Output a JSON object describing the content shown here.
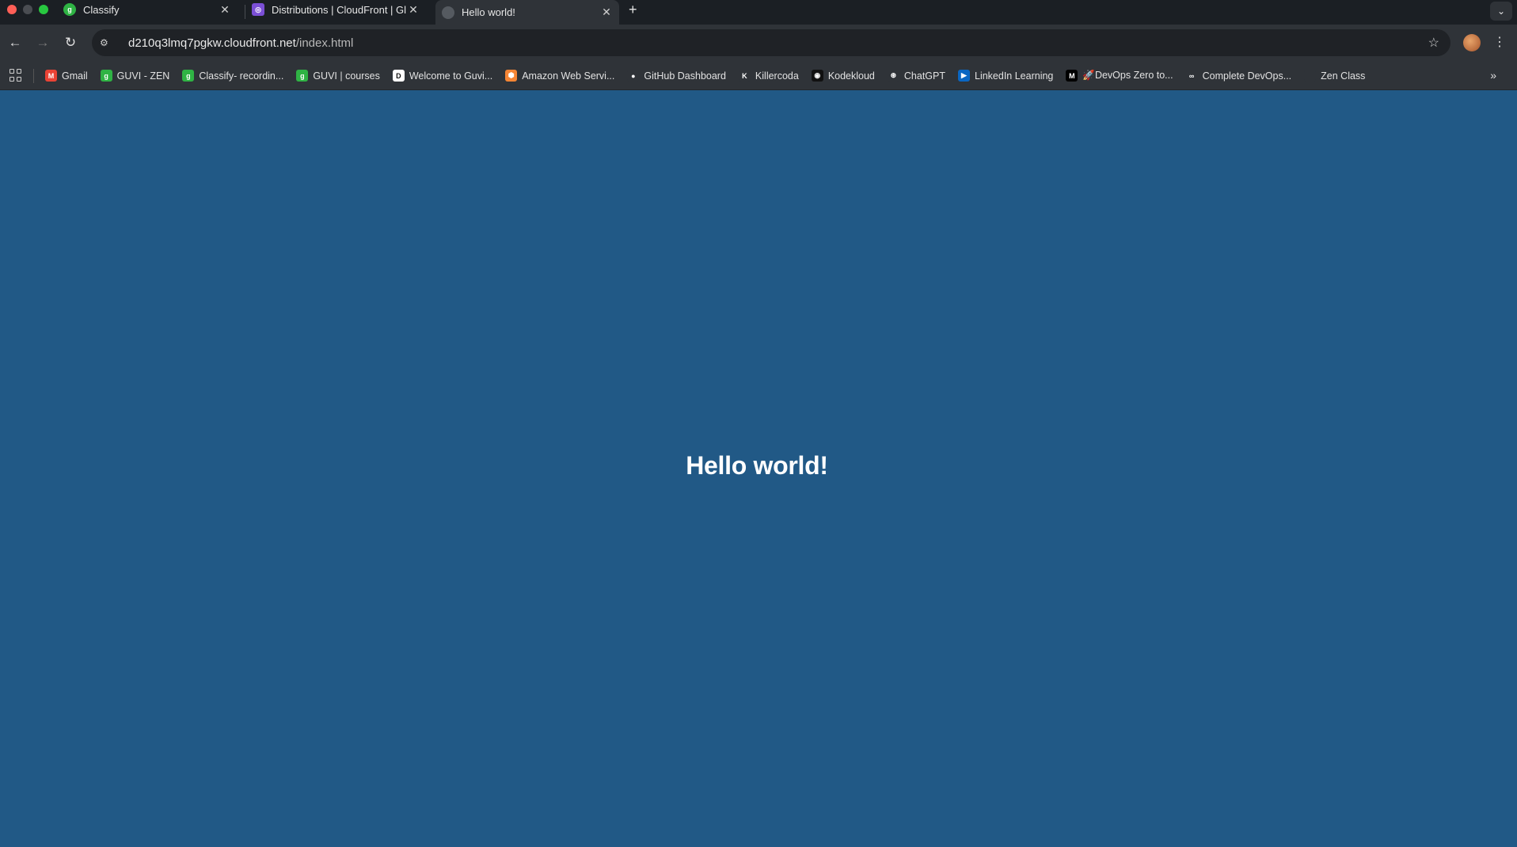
{
  "window": {
    "tabs": [
      {
        "title": "Classify",
        "icon": "guvi-icon",
        "active": false
      },
      {
        "title": "Distributions | CloudFront | Gl",
        "icon": "cloudfront-icon",
        "active": false
      },
      {
        "title": "Hello world!",
        "icon": "globe-icon",
        "active": true
      }
    ],
    "new_tab": "+",
    "tab_list": "⌄"
  },
  "toolbar": {
    "back": "←",
    "forward": "→",
    "reload": "↻",
    "url_host": "d210q3lmq7pgkw.cloudfront.net",
    "url_path": "/index.html",
    "star": "☆",
    "menu": "⋮"
  },
  "bookmarks": {
    "items": [
      {
        "label": "Gmail",
        "icon": "gmail-icon",
        "color": "#ea4335",
        "glyph": "M"
      },
      {
        "label": "GUVI - ZEN",
        "icon": "guvi-icon",
        "color": "#2fb344",
        "glyph": "g"
      },
      {
        "label": "Classify- recordin...",
        "icon": "guvi-icon",
        "color": "#2fb344",
        "glyph": "g"
      },
      {
        "label": "GUVI | courses",
        "icon": "guvi-icon",
        "color": "#2fb344",
        "glyph": "g"
      },
      {
        "label": "Welcome to Guvi...",
        "icon": "doc-icon",
        "color": "#ffffff",
        "glyph": "D"
      },
      {
        "label": "Amazon Web Servi...",
        "icon": "aws-icon",
        "color": "#f58534",
        "glyph": "⬢"
      },
      {
        "label": "GitHub Dashboard",
        "icon": "github-icon",
        "color": "#2f3338",
        "glyph": "●"
      },
      {
        "label": "Killercoda",
        "icon": "killercoda-icon",
        "color": "#2f3338",
        "glyph": "K"
      },
      {
        "label": "Kodekloud",
        "icon": "kodekloud-icon",
        "color": "#111111",
        "glyph": "◉"
      },
      {
        "label": "ChatGPT",
        "icon": "chatgpt-icon",
        "color": "#2f3338",
        "glyph": "⊛"
      },
      {
        "label": "LinkedIn Learning",
        "icon": "linkedin-learning-icon",
        "color": "#0a66c2",
        "glyph": "▶"
      },
      {
        "label": "🚀DevOps Zero to...",
        "icon": "medium-icon",
        "color": "#000000",
        "glyph": "M"
      },
      {
        "label": "Complete DevOps...",
        "icon": "gfg-icon",
        "color": "#2f3338",
        "glyph": "∞"
      },
      {
        "label": "Zen Class",
        "icon": "zen-icon",
        "color": "#2f3338",
        "glyph": ""
      }
    ],
    "more": "»"
  },
  "page": {
    "heading": "Hello world!",
    "background": "#215986"
  }
}
